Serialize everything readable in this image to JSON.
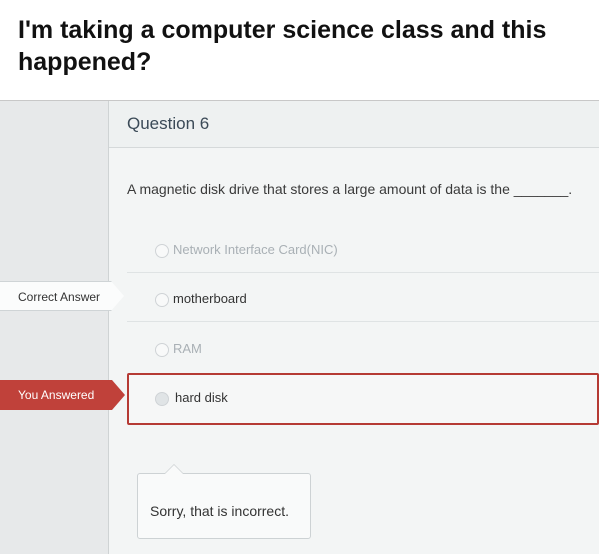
{
  "caption": "I'm taking a computer science class and this happened?",
  "question": {
    "title": "Question 6",
    "text": "A magnetic disk drive that stores a large amount of data is the _______."
  },
  "answers": [
    {
      "label": "Network Interface Card(NIC)",
      "selected": false
    },
    {
      "label": "motherboard",
      "selected": false
    },
    {
      "label": "RAM",
      "selected": false
    },
    {
      "label": "hard disk",
      "selected": true
    }
  ],
  "tags": {
    "correct": "Correct Answer",
    "yours": "You Answered"
  },
  "feedback": "Sorry, that is incorrect.",
  "colors": {
    "wrong_accent": "#c0413a",
    "panel_bg": "#f3f5f5"
  }
}
